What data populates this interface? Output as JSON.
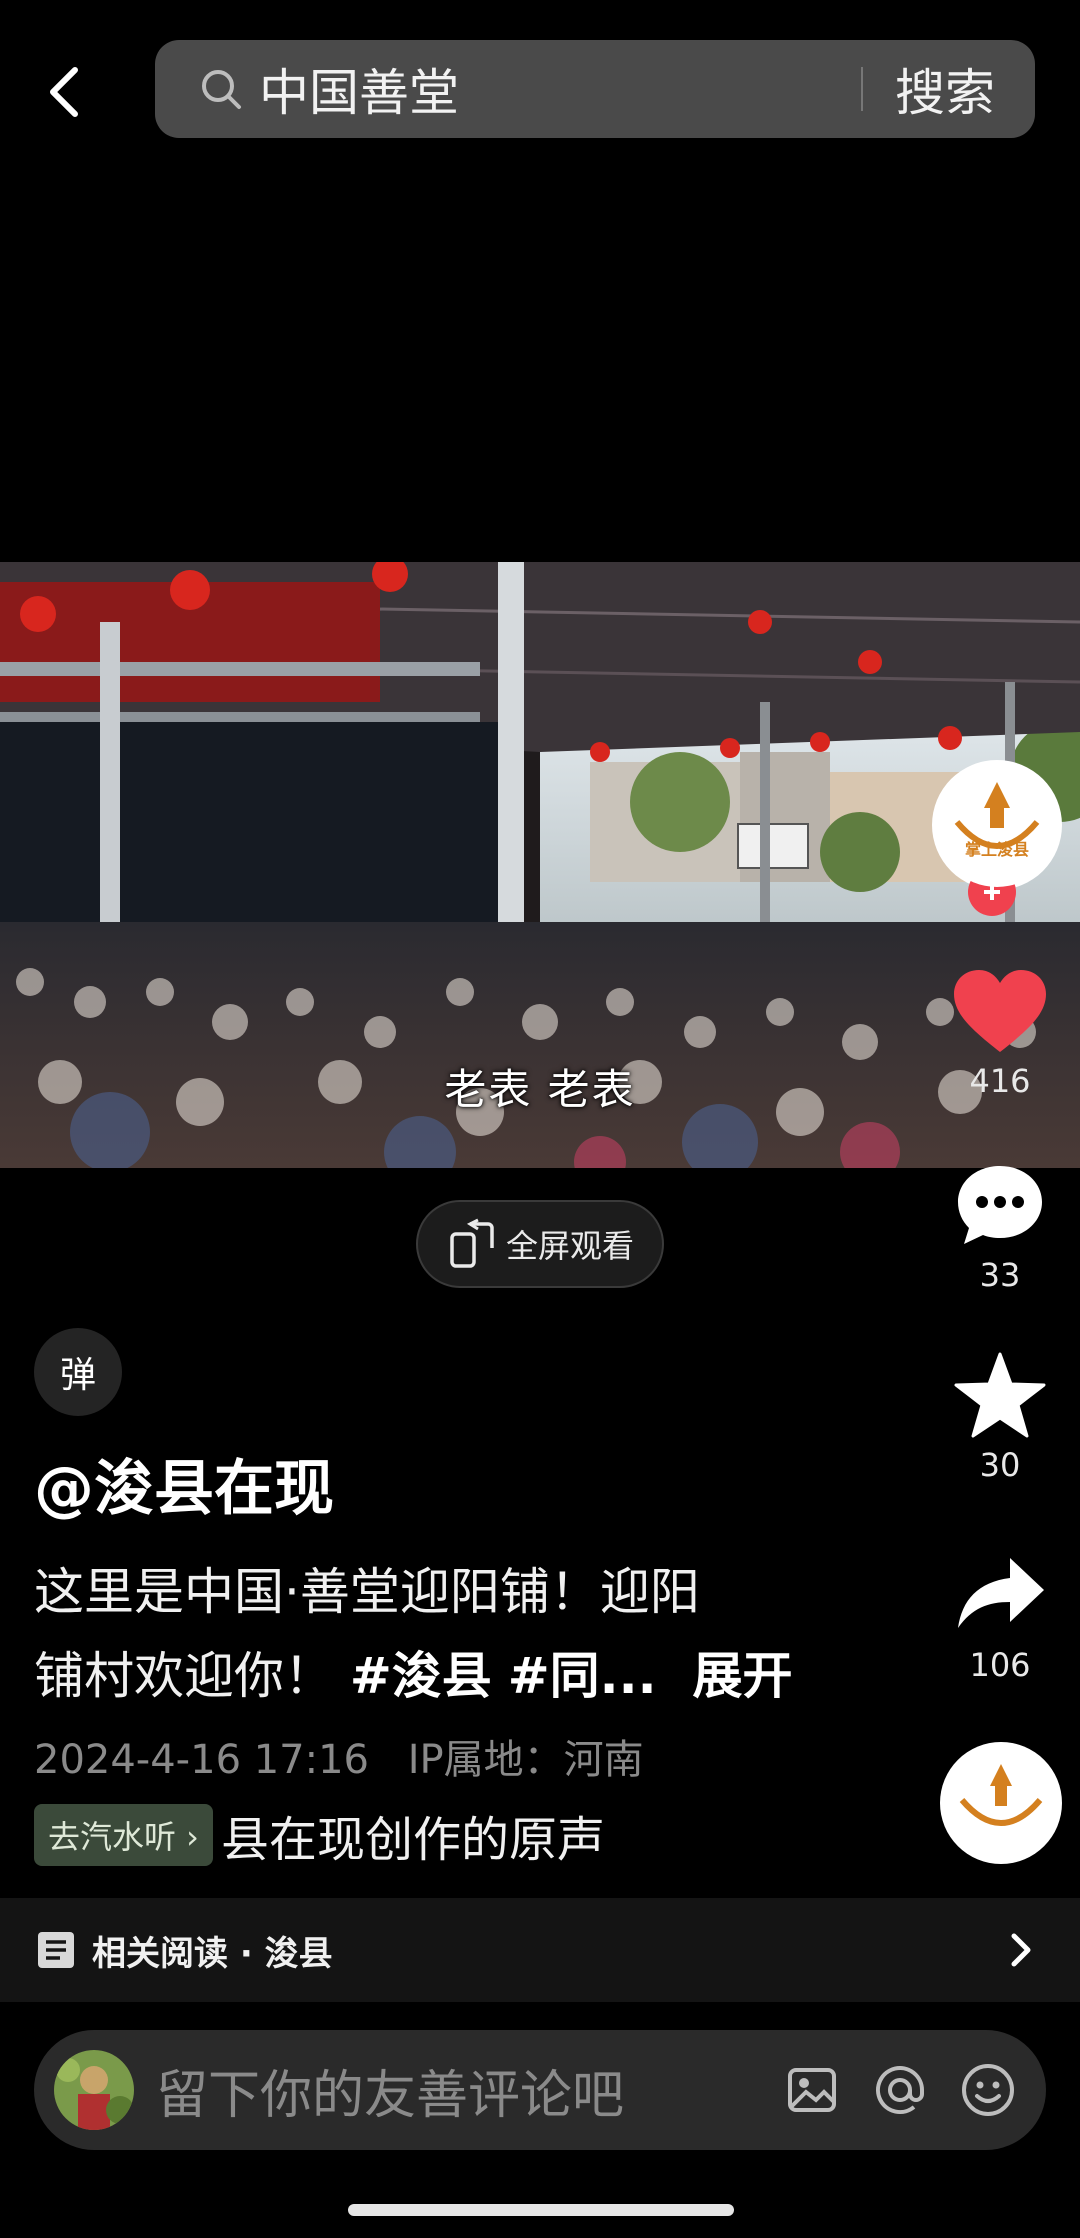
{
  "header": {
    "search_query": "中国善堂",
    "search_button": "搜索"
  },
  "video": {
    "subtitle": "老表 老表",
    "fullscreen_label": "全屏观看"
  },
  "actions": {
    "account_badge": "掌上浚县",
    "likes": "416",
    "comments": "33",
    "favorites": "30",
    "shares": "106"
  },
  "post": {
    "danmaku_label": "弹",
    "author": "@浚县在现",
    "description_line1": "这里是中国·善堂迎阳铺！迎阳",
    "description_line2_text": "铺村欢迎你！",
    "hashtag1": "#浚县",
    "hashtag2": "#同...",
    "expand_label": "展开",
    "date": "2024-4-16 17:16",
    "ip_location": "IP属地：河南",
    "music_tag": "去汽水听 ›",
    "music_text": "县在现创作的原声"
  },
  "related": {
    "label": "相关阅读 · 浚县"
  },
  "comment_bar": {
    "placeholder": "留下你的友善评论吧"
  },
  "colors": {
    "like_red": "#f0414e",
    "background": "#000000",
    "search_bg": "#4a4a4a",
    "badge_orange": "#d4801f"
  },
  "icons": [
    "back-arrow-icon",
    "search-icon",
    "fullscreen-icon",
    "heart-icon",
    "comment-icon",
    "star-icon",
    "share-icon",
    "list-icon",
    "chevron-right-icon",
    "image-icon",
    "at-icon",
    "emoji-icon"
  ]
}
